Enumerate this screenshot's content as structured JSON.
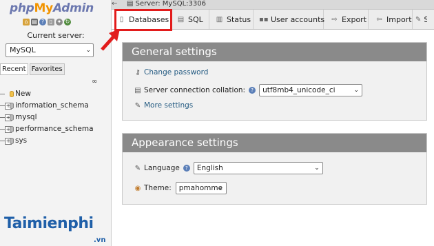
{
  "nav": {
    "logo": {
      "php": "php",
      "my": "My",
      "admin": "Admin"
    },
    "quick_icons": [
      "home-icon",
      "logout-icon",
      "help-icon",
      "docs-icon",
      "settings-icon",
      "reload-icon"
    ],
    "current_server_label": "Current server:",
    "server_select_value": "MySQL",
    "tabs": [
      {
        "label": "Recent"
      },
      {
        "label": "Favorites"
      }
    ],
    "databases": [
      {
        "label": "New"
      },
      {
        "label": "information_schema"
      },
      {
        "label": "mysql"
      },
      {
        "label": "performance_schema"
      },
      {
        "label": "sys"
      }
    ]
  },
  "breadcrumb": {
    "text": "Server: MySQL:3306"
  },
  "tabs": [
    {
      "label": "Databases",
      "icon": "databases-icon",
      "active": true
    },
    {
      "label": "SQL",
      "icon": "sql-icon"
    },
    {
      "label": "Status",
      "icon": "status-icon"
    },
    {
      "label": "User accounts",
      "icon": "user-accounts-icon"
    },
    {
      "label": "Export",
      "icon": "export-icon"
    },
    {
      "label": "Import",
      "icon": "import-icon"
    },
    {
      "label": "S",
      "icon": "settings-icon"
    }
  ],
  "general_settings": {
    "title": "General settings",
    "change_password": "Change password",
    "collation_label": "Server connection collation:",
    "collation_value": "utf8mb4_unicode_ci",
    "more_settings": "More settings"
  },
  "appearance_settings": {
    "title": "Appearance settings",
    "language_label": "Language",
    "language_value": "English",
    "theme_label": "Theme:",
    "theme_value": "pmahomme"
  },
  "watermark": {
    "brand": "Taimienphi",
    "suffix": ".vn"
  },
  "colors": {
    "highlight": "#e21c1c",
    "panel_header": "#8a8a8a",
    "link": "#235a81"
  }
}
